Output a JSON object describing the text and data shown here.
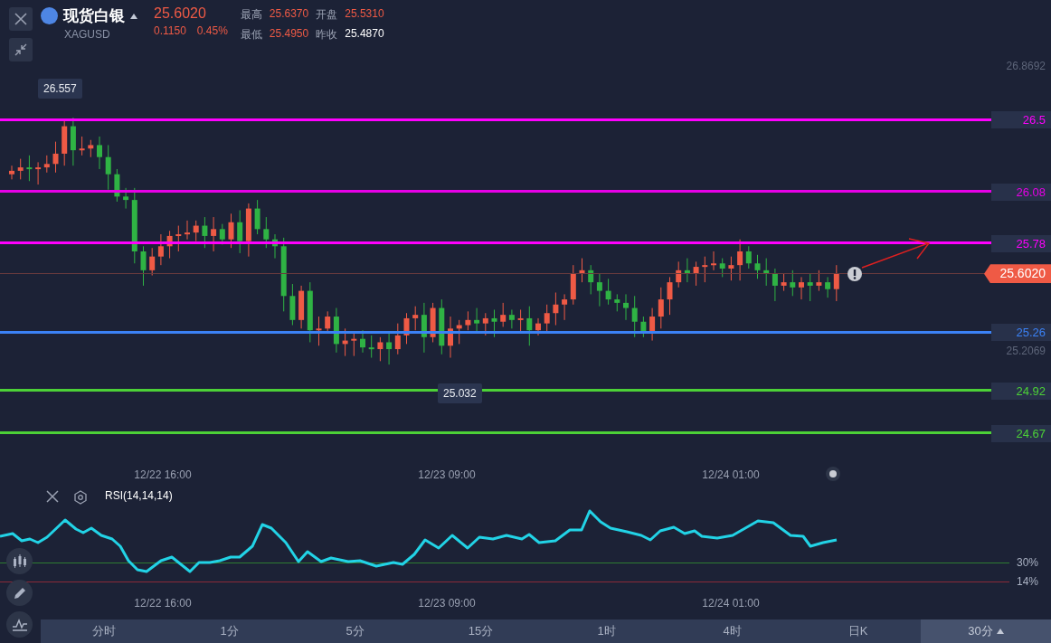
{
  "header": {
    "title": "现货白银",
    "symbol": "XAGUSD",
    "price": "25.6020",
    "change": "0.1150",
    "change_percent": "0.45%",
    "stats": [
      {
        "label": "最高",
        "value": "25.6370",
        "color": "#ef5a45"
      },
      {
        "label": "开盘",
        "value": "25.5310",
        "color": "#ef5a45"
      },
      {
        "label": "最低",
        "value": "25.4950",
        "color": "#ef5a45"
      },
      {
        "label": "昨收",
        "value": "25.4870",
        "color": "#ffffff"
      }
    ]
  },
  "price_axis": [
    "26.8692",
    "25.2069"
  ],
  "price_lines": [
    {
      "value": "26.5",
      "color": "#ff00ff"
    },
    {
      "value": "26.08",
      "color": "#e600e6"
    },
    {
      "value": "25.78",
      "color": "#ff00ff"
    },
    {
      "value": "25.26",
      "color": "#3b82f6"
    },
    {
      "value": "24.92",
      "color": "#4cd137"
    },
    {
      "value": "24.67",
      "color": "#4cd137"
    }
  ],
  "last_price": "25.6020",
  "high_marker": "26.557",
  "low_marker": "25.032",
  "time_axis": [
    "12/22 16:00",
    "12/23 09:00",
    "12/24 01:00"
  ],
  "indicator": {
    "name": "RSI(14,14,14)",
    "levels": [
      {
        "label": "30%",
        "color": "#2e7d32"
      },
      {
        "label": "14%",
        "color": "#8b2a38"
      }
    ],
    "time_axis": [
      "12/22 16:00",
      "12/23 09:00",
      "12/24 01:00"
    ]
  },
  "periods": [
    {
      "label": "分时",
      "selected": false,
      "kind": "tab"
    },
    {
      "label": "1分",
      "selected": false,
      "kind": "tab"
    },
    {
      "label": "5分",
      "selected": false,
      "kind": "tab"
    },
    {
      "label": "15分",
      "selected": false,
      "kind": "tab"
    },
    {
      "label": "1时",
      "selected": false,
      "kind": "tab"
    },
    {
      "label": "4时",
      "selected": false,
      "kind": "tab"
    },
    {
      "label": "日K",
      "selected": false,
      "kind": "tab"
    },
    {
      "label": "30分",
      "selected": true,
      "kind": "dropdown"
    }
  ]
}
